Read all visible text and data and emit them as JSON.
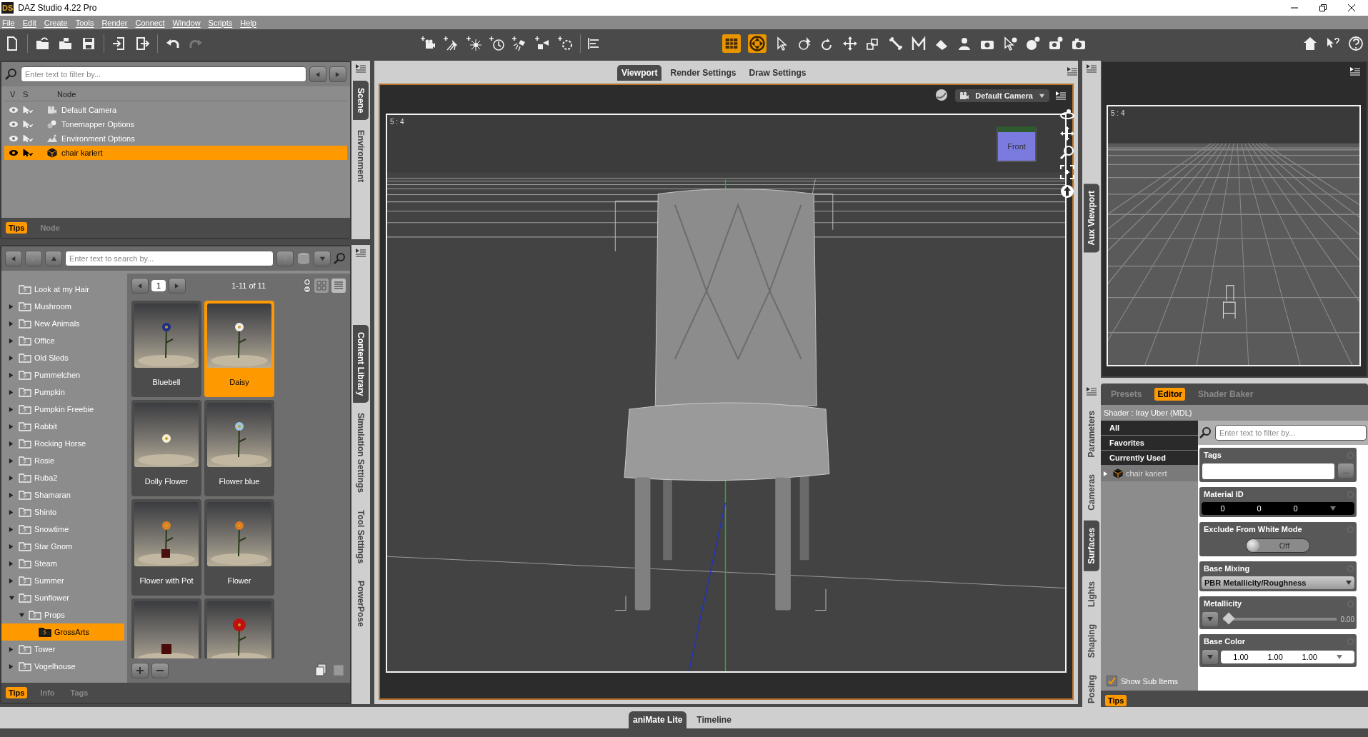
{
  "window": {
    "logo": "DS",
    "title": "DAZ Studio 4.22 Pro"
  },
  "menu": [
    "File",
    "Edit",
    "Create",
    "Tools",
    "Render",
    "Connect",
    "Window",
    "Scripts",
    "Help"
  ],
  "scene": {
    "filter_placeholder": "Enter text to filter by...",
    "columns": [
      "V",
      "S",
      "Node"
    ],
    "nodes": [
      {
        "name": "Default Camera",
        "kind": "camera",
        "selected": false
      },
      {
        "name": "Tonemapper Options",
        "kind": "tonemapper",
        "selected": false
      },
      {
        "name": "Environment Options",
        "kind": "environment",
        "selected": false
      },
      {
        "name": "chair kariert",
        "kind": "figure",
        "selected": true
      }
    ],
    "bottom_tabs": [
      {
        "label": "Tips",
        "selected": true
      },
      {
        "label": "Node",
        "selected": false
      }
    ],
    "side_tabs": [
      {
        "label": "Scene",
        "selected": true
      },
      {
        "label": "Environment",
        "selected": false
      }
    ]
  },
  "content_library": {
    "search_placeholder": "Enter text to search by...",
    "page": "1",
    "count": "1-11 of 11",
    "folders": [
      {
        "name": "Look at my Hair",
        "expandable": false,
        "selected": false
      },
      {
        "name": "Mushroom",
        "expandable": true,
        "expanded": false,
        "selected": false
      },
      {
        "name": "New Animals",
        "expandable": true,
        "expanded": false,
        "selected": false
      },
      {
        "name": "Office",
        "expandable": true,
        "expanded": false,
        "selected": false
      },
      {
        "name": "Old Sleds",
        "expandable": true,
        "expanded": false,
        "selected": false
      },
      {
        "name": "Pummelchen",
        "expandable": true,
        "expanded": false,
        "selected": false
      },
      {
        "name": "Pumpkin",
        "expandable": true,
        "expanded": false,
        "selected": false
      },
      {
        "name": "Pumpkin Freebie",
        "expandable": true,
        "expanded": false,
        "selected": false
      },
      {
        "name": "Rabbit",
        "expandable": true,
        "expanded": false,
        "selected": false
      },
      {
        "name": "Rocking Horse",
        "expandable": true,
        "expanded": false,
        "selected": false
      },
      {
        "name": "Rosie",
        "expandable": true,
        "expanded": false,
        "selected": false
      },
      {
        "name": "Ruba2",
        "expandable": true,
        "expanded": false,
        "selected": false
      },
      {
        "name": "Shamaran",
        "expandable": true,
        "expanded": false,
        "selected": false
      },
      {
        "name": "Shinto",
        "expandable": true,
        "expanded": false,
        "selected": false
      },
      {
        "name": "Snowtime",
        "expandable": true,
        "expanded": false,
        "selected": false
      },
      {
        "name": "Star Gnom",
        "expandable": true,
        "expanded": false,
        "selected": false
      },
      {
        "name": "Steam",
        "expandable": true,
        "expanded": false,
        "selected": false
      },
      {
        "name": "Summer",
        "expandable": true,
        "expanded": false,
        "selected": false
      },
      {
        "name": "Sunflower",
        "expandable": true,
        "expanded": true,
        "selected": false,
        "children": [
          {
            "name": "Props",
            "expandable": true,
            "expanded": true,
            "selected": false,
            "children": [
              {
                "name": "GrossArts",
                "expandable": false,
                "selected": true
              }
            ]
          }
        ]
      },
      {
        "name": "Tower",
        "expandable": true,
        "expanded": false,
        "selected": false
      },
      {
        "name": "Vogelhouse",
        "expandable": true,
        "expanded": false,
        "selected": false
      }
    ],
    "items": [
      {
        "label": "Bluebell",
        "selected": false
      },
      {
        "label": "Daisy",
        "selected": true
      },
      {
        "label": "Dolly Flower",
        "selected": false
      },
      {
        "label": "Flower blue",
        "selected": false
      },
      {
        "label": "Flower with Pot",
        "selected": false
      },
      {
        "label": "Flower",
        "selected": false
      },
      {
        "selected": false
      },
      {
        "selected": false
      }
    ],
    "bottom_tabs": [
      {
        "label": "Tips",
        "selected": true
      },
      {
        "label": "Info",
        "selected": false
      },
      {
        "label": "Tags",
        "selected": false
      }
    ],
    "side_tabs": [
      {
        "label": "Content Library",
        "selected": true
      },
      {
        "label": "Simulation Settings",
        "selected": false
      },
      {
        "label": "Tool Settings",
        "selected": false
      },
      {
        "label": "PowerPose",
        "selected": false
      }
    ]
  },
  "viewport": {
    "tabs": [
      {
        "label": "Viewport",
        "selected": true
      },
      {
        "label": "Render Settings",
        "selected": false
      },
      {
        "label": "Draw Settings",
        "selected": false
      }
    ],
    "camera": "Default Camera",
    "aspect": "5 : 4",
    "view_cube": "Front"
  },
  "aux_viewport": {
    "tab": "Aux Viewport",
    "aspect": "5 : 4"
  },
  "surfaces": {
    "side_tabs": [
      {
        "label": "Parameters",
        "selected": false
      },
      {
        "label": "Cameras",
        "selected": false
      },
      {
        "label": "Surfaces",
        "selected": true
      },
      {
        "label": "Lights",
        "selected": false
      },
      {
        "label": "Shaping",
        "selected": false
      },
      {
        "label": "Posing",
        "selected": false
      }
    ],
    "tabs": [
      {
        "label": "Presets",
        "selected": false
      },
      {
        "label": "Editor",
        "selected": true
      },
      {
        "label": "Shader Baker",
        "selected": false
      }
    ],
    "shader": "Shader : Iray Uber (MDL)",
    "groups": [
      {
        "label": "All"
      },
      {
        "label": "Favorites"
      },
      {
        "label": "Currently Used"
      }
    ],
    "tree": [
      {
        "name": "chair kariert",
        "expanded": false
      }
    ],
    "show_sub_items": {
      "label": "Show Sub Items",
      "checked": true
    },
    "filter_placeholder": "Enter text to filter by...",
    "properties": [
      {
        "kind": "text",
        "label": "Tags",
        "button": "..."
      },
      {
        "kind": "triple",
        "label": "Material ID",
        "values": [
          "0",
          "0",
          "0"
        ],
        "dark": true
      },
      {
        "kind": "toggle",
        "label": "Exclude From White Mode",
        "on": false,
        "reading": "Off"
      },
      {
        "kind": "dropdown",
        "label": "Base Mixing",
        "value": "PBR Metallicity/Roughness"
      },
      {
        "kind": "slider",
        "label": "Metallicity",
        "level": 0,
        "reading": "0.00"
      },
      {
        "kind": "triple",
        "label": "Base Color",
        "values": [
          "1.00",
          "1.00",
          "1.00"
        ],
        "dark": false
      }
    ],
    "bottom_tabs": [
      {
        "label": "Tips",
        "selected": true
      }
    ]
  },
  "bottom_tabs": [
    {
      "label": "aniMate Lite",
      "selected": true
    },
    {
      "label": "Timeline",
      "selected": false
    }
  ]
}
